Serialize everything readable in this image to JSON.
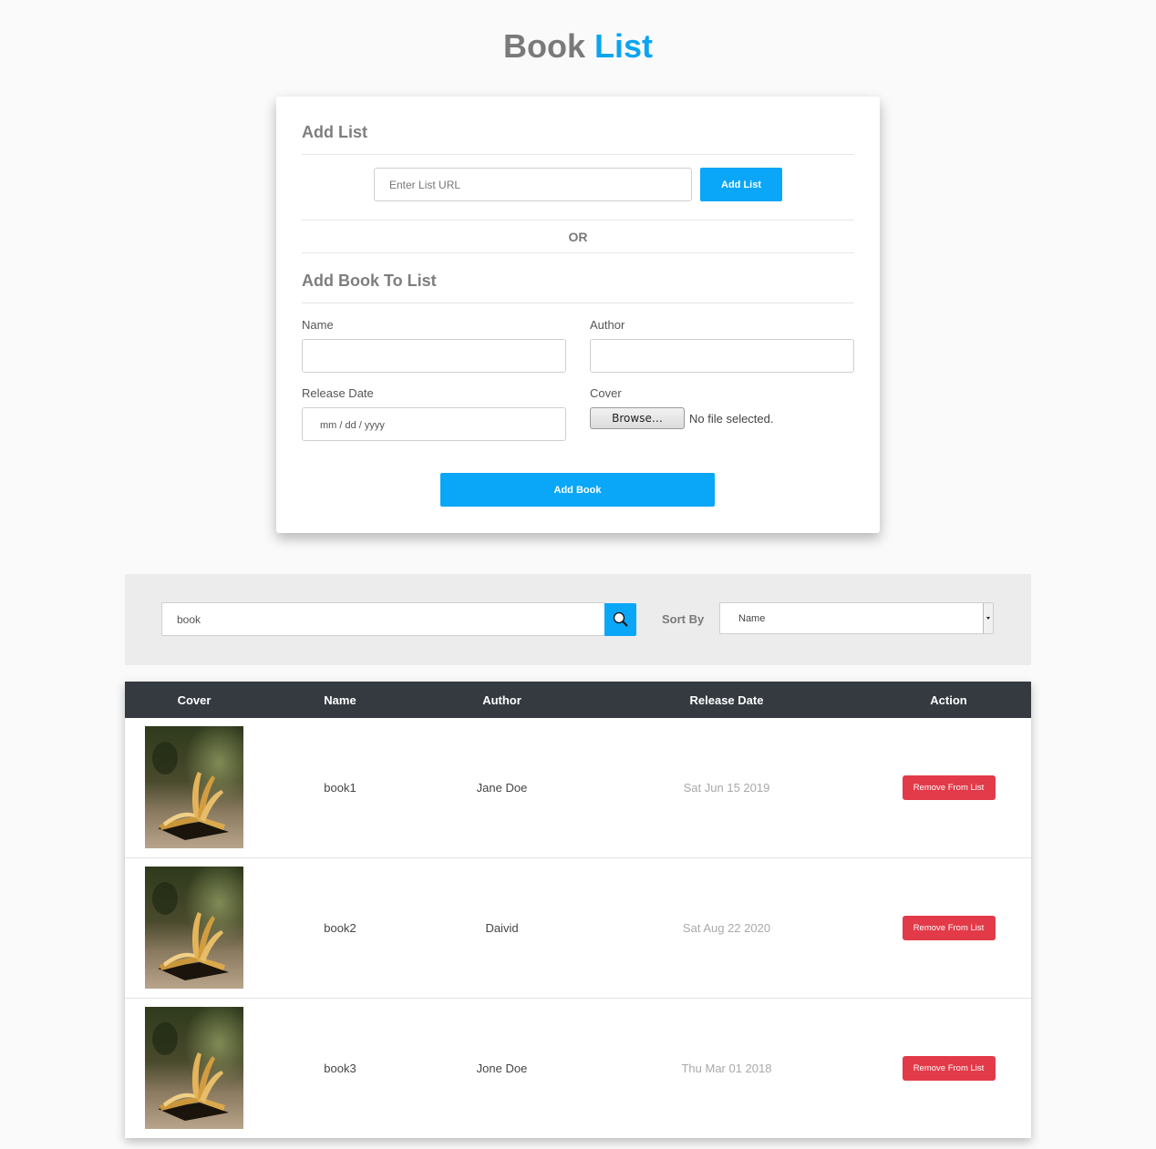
{
  "header": {
    "title_part1": "Book",
    "title_part2": "List"
  },
  "add_list": {
    "heading": "Add List",
    "url_placeholder": "Enter List URL",
    "url_value": "",
    "button_label": "Add List"
  },
  "separator": "OR",
  "add_book": {
    "heading": "Add Book To List",
    "name_label": "Name",
    "author_label": "Author",
    "release_label": "Release Date",
    "release_placeholder": "mm / dd / yyyy",
    "cover_label": "Cover",
    "browse_label": "Browse…",
    "no_file": "No file selected.",
    "button_label": "Add Book"
  },
  "filter": {
    "search_value": "book",
    "sort_label": "Sort By",
    "sort_selected": "Name"
  },
  "table": {
    "columns": [
      "Cover",
      "Name",
      "Author",
      "Release Date",
      "Action"
    ],
    "rows": [
      {
        "name": "book1",
        "author": "Jane Doe",
        "release_date": "Sat Jun 15 2019",
        "action": "Remove From List"
      },
      {
        "name": "book2",
        "author": "Daivid",
        "release_date": "Sat Aug 22 2020",
        "action": "Remove From List"
      },
      {
        "name": "book3",
        "author": "Jone Doe",
        "release_date": "Thu Mar 01 2018",
        "action": "Remove From List"
      }
    ]
  },
  "colors": {
    "accent": "#0aa6f8",
    "danger": "#e23a48",
    "table_header": "#343a40"
  }
}
